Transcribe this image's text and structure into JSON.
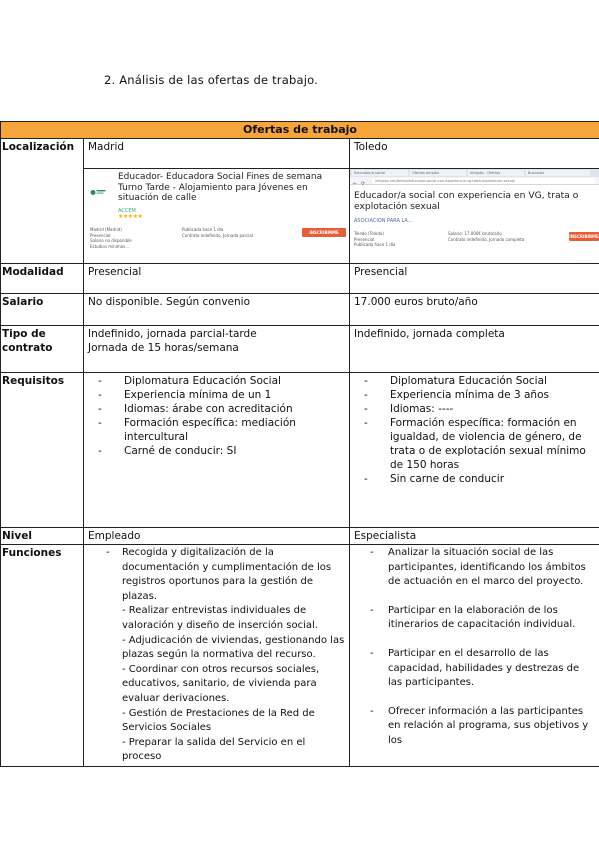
{
  "heading": "2.  Análisis de las ofertas de trabajo.",
  "table": {
    "title": "Ofertas de trabajo",
    "labels": {
      "localizacion": "Localización",
      "modalidad": "Modalidad",
      "salario": "Salario",
      "tipo_contrato": "Tipo de contrato",
      "requisitos": "Requisitos",
      "nivel": "Nivel",
      "funciones": "Funciones"
    },
    "madrid": {
      "localizacion": "Madrid",
      "ad": {
        "title": "Educador- Educadora Social Fines de semana Turno Tarde - Alojamiento para Jóvenes en situación de calle",
        "company": "ACCEM",
        "stars": "★★★★★",
        "details_left": [
          "Madrid (Madrid)",
          "Presencial",
          "Salario no disponible",
          "Estudios mínimos..."
        ],
        "details_right": [
          "Publicada hace 1 día",
          "Contrato indefinido, Jornada parcial"
        ],
        "button": "INSCRIBIRME"
      },
      "modalidad": "Presencial",
      "salario": "No disponible. Según convenio",
      "tipo_contrato": [
        "Indefinido, jornada parcial-tarde",
        "Jornada de 15 horas/semana"
      ],
      "requisitos": [
        "Diplomatura Educación Social",
        "Experiencia mínima de un 1",
        "Idiomas: árabe con acreditación",
        "Formación específica: mediación intercultural",
        "Carné de conducir: SI"
      ],
      "nivel": "Empleado",
      "funciones": [
        "Recogida y digitalización de la documentación y cumplimentación de los registros oportunos para la gestión de plazas.",
        "- Realizar entrevistas individuales de valoración y diseño de inserción social.",
        "- Adjudicación de viviendas, gestionando las plazas según la normativa del recurso.",
        "- Coordinar con otros recursos sociales, educativos, sanitario, de vivienda para evaluar derivaciones.",
        "- Gestión de Prestaciones de la Red de Servicios Sociales",
        "- Preparar la salida del Servicio en el proceso"
      ]
    },
    "toledo": {
      "localizacion": "Toledo",
      "ad": {
        "tabs": [
          "Educador/a social",
          "Ofertas empleo",
          "Infojobs - Ofertas",
          "Buscador"
        ],
        "url": "infojobs.net/toledo/educador-social-con-experiencia-vg-trata-explotacion-sexual",
        "title": "Educador/a social con experiencia en VG, trata o explotación sexual",
        "company": "ASOCIACIÓN PARA LA...",
        "details_left": [
          "Toledo (Toledo)",
          "Presencial",
          "Publicada hace 1 día"
        ],
        "details_right": [
          "Salario: 17.000€ bruto/año",
          "Contrato indefinido, Jornada completa"
        ],
        "button": "INSCRIBIRME"
      },
      "modalidad": "Presencial",
      "salario": "17.000 euros bruto/año",
      "tipo_contrato": "Indefinido, jornada completa",
      "requisitos": [
        "Diplomatura Educación Social",
        "Experiencia mínima de 3 años",
        "Idiomas: ----",
        "Formación específica: formación en igualdad, de violencia de género, de trata o de explotación sexual mínimo de 150 horas",
        "Sin carne de conducir"
      ],
      "nivel": "Especialista",
      "funciones": [
        "Analizar la situación social de las participantes, identificando los ámbitos de actuación en el marco del proyecto.",
        "Participar en la elaboración de los itinerarios de capacitación individual.",
        "Participar en el desarrollo de las capacidad, habilidades y destrezas de las participantes.",
        "Ofrecer información a las participantes en relación al programa, sus objetivos y los"
      ]
    }
  },
  "colors": {
    "title_bg": "#f6a53a",
    "button": "#e85c38",
    "border": "#222222"
  }
}
